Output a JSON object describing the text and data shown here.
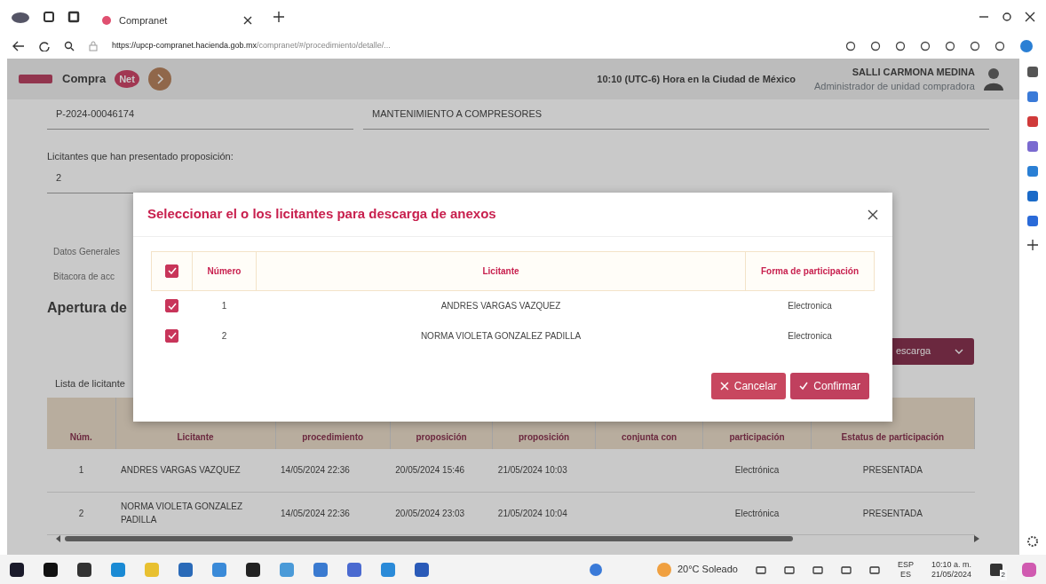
{
  "browser": {
    "tab_title": "Compranet",
    "url": "https://upcp-compranet.hacienda.gob.mx/compranet/#/procedimiento/detalle/..."
  },
  "header": {
    "logo_prefix": "Compra",
    "logo_suffix": "Net",
    "time": "10:10 (UTC-6) Hora en la Ciudad de México",
    "user_name": "SALLI CARMONA MEDINA",
    "user_role": "Administrador de unidad compradora"
  },
  "fields": [
    {
      "value": "P-2024-00046174"
    },
    {
      "value": "MANTENIMIENTO A COMPRESORES"
    }
  ],
  "bidders_count": {
    "label": "Licitantes que han presentado proposición:",
    "value": "2"
  },
  "side_links": [
    {
      "label": "Datos Generales"
    },
    {
      "label": "Bitacora de acc"
    }
  ],
  "section_title": "Apertura de",
  "list_label": "Lista de licitante",
  "download_button": "escarga",
  "table": {
    "columns": [
      "Núm.",
      "Licitante",
      "procedimiento",
      "proposición",
      "proposición",
      "conjunta con",
      "participación",
      "Estatus de participación"
    ],
    "rows": [
      [
        "1",
        "ANDRES VARGAS VAZQUEZ",
        "14/05/2024 22:36",
        "20/05/2024 15:46",
        "21/05/2024 10:03",
        "",
        "Electrónica",
        "PRESENTADA"
      ],
      [
        "2",
        "NORMA VIOLETA GONZALEZ PADILLA",
        "14/05/2024 22:36",
        "20/05/2024 23:03",
        "21/05/2024 10:04",
        "",
        "Electrónica",
        "PRESENTADA"
      ]
    ]
  },
  "modal": {
    "title": "Seleccionar el o los licitantes para descarga de anexos",
    "select_all_checked": true,
    "columns": [
      "Número",
      "Licitante",
      "Forma de participación"
    ],
    "rows": [
      {
        "checked": true,
        "number": "1",
        "bidder": "ANDRES VARGAS VAZQUEZ",
        "participation": "Electronica"
      },
      {
        "checked": true,
        "number": "2",
        "bidder": "NORMA VIOLETA GONZALEZ PADILLA",
        "participation": "Electronica"
      }
    ],
    "buttons": [
      {
        "kind": "cancel",
        "label": "Cancelar"
      },
      {
        "kind": "confirm",
        "label": "Confirmar"
      }
    ]
  },
  "taskbar": {
    "weather": "20°C Soleado",
    "lang_top": "ESP",
    "lang_bottom": "ES",
    "time": "10:10 a. m.",
    "date": "21/05/2024",
    "notifications": "2"
  }
}
